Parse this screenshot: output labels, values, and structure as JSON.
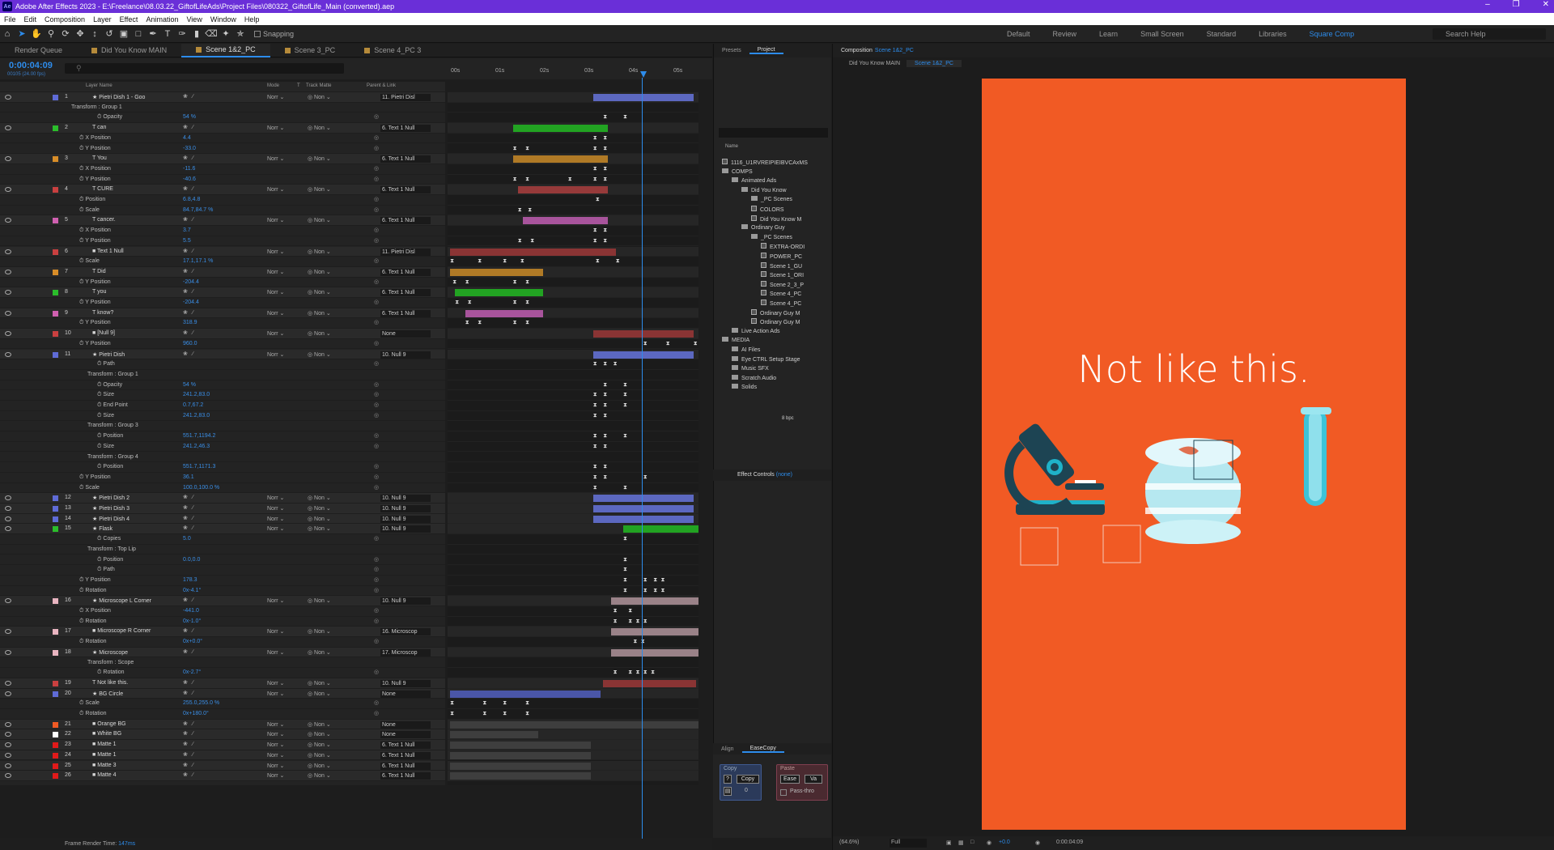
{
  "app": {
    "title": "Adobe After Effects 2023 - E:\\Freelance\\08.03.22_GiftofLifeAds\\Project Files\\080322_GiftofLife_Main (converted).aep",
    "logo": "Ae"
  },
  "menu": [
    "File",
    "Edit",
    "Composition",
    "Layer",
    "Effect",
    "Animation",
    "View",
    "Window",
    "Help"
  ],
  "toolbar": {
    "snapping_label": "Snapping",
    "workspaces": [
      "Default",
      "Review",
      "Learn",
      "Small Screen",
      "Standard",
      "Libraries",
      "Square Comp"
    ],
    "active_workspace": "Square Comp",
    "search_help": "Search Help"
  },
  "timeline": {
    "tabs": [
      "Render Queue",
      "Did You Know MAIN",
      "Scene 1&2_PC",
      "Scene 3_PC",
      "Scene 4_PC 3"
    ],
    "active_tab": "Scene 1&2_PC",
    "timecode": "0:00:04:09",
    "fps": "00105 (24.00 fps)",
    "ruler": [
      "00s",
      "01s",
      "02s",
      "03s",
      "04s",
      "05s"
    ],
    "columns": {
      "layer_name": "Layer Name",
      "mode": "Mode",
      "t": "T",
      "track_matte": "Track Matte",
      "parent": "Parent & Link"
    },
    "render_time_label": "Frame Render Time:",
    "render_time_value": "147ms"
  },
  "rows": [
    {
      "t": "L",
      "num": "1",
      "name": "Pietri Dish 1 - Goo",
      "label": "#5f6bd6",
      "type": "star",
      "parent": "11. Pietri Disl",
      "bar": [
        58,
        98
      ],
      "barc": "#5c68c0"
    },
    {
      "t": "G",
      "name": "Transform : Group 1",
      "ind": 88
    },
    {
      "t": "P",
      "name": "Opacity",
      "ind": 120,
      "val": "54 %",
      "kf": [
        62,
        70
      ]
    },
    {
      "t": "L",
      "num": "2",
      "name": "can",
      "label": "#2bbd2b",
      "type": "T",
      "parent": "6. Text 1 Null",
      "bar": [
        26,
        64
      ],
      "barc": "#22a322"
    },
    {
      "t": "P",
      "name": "X Position",
      "ind": 98,
      "val": "4.4",
      "kf": [
        58,
        62
      ]
    },
    {
      "t": "P",
      "name": "Y Position",
      "ind": 98,
      "val": "-33.0",
      "kf": [
        26,
        31,
        58,
        62
      ]
    },
    {
      "t": "L",
      "num": "3",
      "name": "You",
      "label": "#d88d28",
      "type": "T",
      "parent": "6. Text 1 Null",
      "bar": [
        26,
        64
      ],
      "barc": "#b07a26"
    },
    {
      "t": "P",
      "name": "X Position",
      "ind": 98,
      "val": "-11.6",
      "kf": [
        58,
        62
      ]
    },
    {
      "t": "P",
      "name": "Y Position",
      "ind": 98,
      "val": "-40.6",
      "kf": [
        26,
        31,
        48,
        58,
        62
      ]
    },
    {
      "t": "L",
      "num": "4",
      "name": "CURE",
      "label": "#c94040",
      "type": "T",
      "parent": "6. Text 1 Null",
      "bar": [
        28,
        64
      ],
      "barc": "#963a3a"
    },
    {
      "t": "P",
      "name": "Position",
      "ind": 98,
      "val": "6.8,4.8",
      "kf": [
        59
      ]
    },
    {
      "t": "P",
      "name": "Scale",
      "ind": 98,
      "val": "84.7,84.7 %",
      "kf": [
        28,
        32
      ]
    },
    {
      "t": "L",
      "num": "5",
      "name": "cancer.",
      "label": "#d060b0",
      "type": "T",
      "parent": "6. Text 1 Null",
      "bar": [
        30,
        64
      ],
      "barc": "#a8549c"
    },
    {
      "t": "P",
      "name": "X Position",
      "ind": 98,
      "val": "3.7",
      "kf": [
        58,
        62
      ]
    },
    {
      "t": "P",
      "name": "Y Position",
      "ind": 98,
      "val": "5.5",
      "kf": [
        28,
        33,
        58,
        62
      ]
    },
    {
      "t": "L",
      "num": "6",
      "name": "Text 1 Null",
      "label": "#c94040",
      "type": "n",
      "parent": "11. Pietri Disl",
      "bar": [
        1,
        67
      ],
      "barc": "#8a3434"
    },
    {
      "t": "P",
      "name": "Scale",
      "ind": 98,
      "val": "17.1,17.1 %",
      "kf": [
        1,
        12,
        22,
        29,
        59,
        67
      ]
    },
    {
      "t": "L",
      "num": "7",
      "name": "Did",
      "label": "#d88d28",
      "type": "T",
      "parent": "6. Text 1 Null",
      "bar": [
        1,
        38
      ],
      "barc": "#b07a26"
    },
    {
      "t": "P",
      "name": "Y Position",
      "ind": 98,
      "val": "-204.4",
      "kf": [
        2,
        7,
        26,
        31
      ]
    },
    {
      "t": "L",
      "num": "8",
      "name": "you",
      "label": "#2bbd2b",
      "type": "T",
      "parent": "6. Text 1 Null",
      "bar": [
        3,
        38
      ],
      "barc": "#22a322"
    },
    {
      "t": "P",
      "name": "Y Position",
      "ind": 98,
      "val": "-204.4",
      "kf": [
        3,
        8,
        26,
        31
      ]
    },
    {
      "t": "L",
      "num": "9",
      "name": "know?",
      "label": "#d060b0",
      "type": "T",
      "parent": "6. Text 1 Null",
      "bar": [
        7,
        38
      ],
      "barc": "#a8549c"
    },
    {
      "t": "P",
      "name": "Y Position",
      "ind": 98,
      "val": "318.9",
      "kf": [
        7,
        12,
        26,
        31
      ]
    },
    {
      "t": "L",
      "num": "10",
      "name": "[Null 9]",
      "label": "#c94040",
      "type": "n",
      "parent": "None",
      "bar": [
        58,
        98
      ],
      "barc": "#8a3434"
    },
    {
      "t": "P",
      "name": "Y Position",
      "ind": 98,
      "val": "960.0",
      "kf": [
        78,
        87,
        98
      ]
    },
    {
      "t": "L",
      "num": "11",
      "name": "Pietri Dish",
      "label": "#5f6bd6",
      "type": "star",
      "parent": "10. Null 9",
      "bar": [
        58,
        98
      ],
      "barc": "#5c68c0"
    },
    {
      "t": "P",
      "name": "Path",
      "ind": 120,
      "val": "",
      "kf": [
        58,
        62,
        66
      ]
    },
    {
      "t": "G",
      "name": "Transform : Group 1",
      "ind": 108
    },
    {
      "t": "P",
      "name": "Opacity",
      "ind": 120,
      "val": "54 %",
      "kf": [
        62,
        70
      ]
    },
    {
      "t": "P",
      "name": "Size",
      "ind": 120,
      "val": "241.2,83.0",
      "kf": [
        58,
        62,
        70
      ]
    },
    {
      "t": "P",
      "name": "End Point",
      "ind": 120,
      "val": "0.7,67.2",
      "kf": [
        58,
        62,
        70
      ]
    },
    {
      "t": "P",
      "name": "Size",
      "ind": 120,
      "val": "241.2,83.0",
      "kf": [
        58,
        62
      ]
    },
    {
      "t": "G",
      "name": "Transform : Group 3",
      "ind": 108
    },
    {
      "t": "P",
      "name": "Position",
      "ind": 120,
      "val": "551.7,1194.2",
      "kf": [
        58,
        62,
        70
      ]
    },
    {
      "t": "P",
      "name": "Size",
      "ind": 120,
      "val": "241.2,46.3",
      "kf": [
        58,
        62
      ]
    },
    {
      "t": "G",
      "name": "Transform : Group 4",
      "ind": 108
    },
    {
      "t": "P",
      "name": "Position",
      "ind": 120,
      "val": "551.7,1171.3",
      "kf": [
        58,
        62
      ]
    },
    {
      "t": "P",
      "name": "Y Position",
      "ind": 98,
      "val": "36.1",
      "kf": [
        58,
        62,
        78
      ]
    },
    {
      "t": "P",
      "name": "Scale",
      "ind": 98,
      "val": "100.0,100.0 %",
      "kf": [
        58,
        70
      ]
    },
    {
      "t": "L",
      "num": "12",
      "name": "Pietri Dish 2",
      "label": "#5f6bd6",
      "type": "star",
      "parent": "10. Null 9",
      "bar": [
        58,
        98
      ],
      "barc": "#5c68c0"
    },
    {
      "t": "L",
      "num": "13",
      "name": "Pietri Dish 3",
      "label": "#5f6bd6",
      "type": "star",
      "parent": "10. Null 9",
      "bar": [
        58,
        98
      ],
      "barc": "#5c68c0"
    },
    {
      "t": "L",
      "num": "14",
      "name": "Pietri Dish 4",
      "label": "#5f6bd6",
      "type": "star",
      "parent": "10. Null 9",
      "bar": [
        58,
        98
      ],
      "barc": "#5c68c0"
    },
    {
      "t": "L",
      "num": "15",
      "name": "Flask",
      "label": "#2bbd2b",
      "type": "star",
      "parent": "10. Null 9",
      "bar": [
        70,
        100
      ],
      "barc": "#22a322"
    },
    {
      "t": "P",
      "name": "Copies",
      "ind": 120,
      "val": "5.0",
      "kf": [
        70
      ]
    },
    {
      "t": "G",
      "name": "Transform : Top Lip",
      "ind": 108
    },
    {
      "t": "P",
      "name": "Position",
      "ind": 120,
      "val": "0.0,0.0",
      "kf": [
        70
      ]
    },
    {
      "t": "P",
      "name": "Path",
      "ind": 120,
      "val": "",
      "kf": [
        70
      ]
    },
    {
      "t": "P",
      "name": "Y Position",
      "ind": 98,
      "val": "178.3",
      "kf": [
        70,
        78,
        82,
        85
      ]
    },
    {
      "t": "P",
      "name": "Rotation",
      "ind": 98,
      "val": "0x-4.1°",
      "kf": [
        70,
        78,
        82,
        85
      ]
    },
    {
      "t": "L",
      "num": "16",
      "name": "Microscope L Corner",
      "label": "#e8b4c0",
      "type": "star",
      "parent": "10. Null 9",
      "bar": [
        65,
        100
      ],
      "barc": "#9a8288"
    },
    {
      "t": "P",
      "name": "X Position",
      "ind": 98,
      "val": "-441.0",
      "kf": [
        66,
        72
      ]
    },
    {
      "t": "P",
      "name": "Rotation",
      "ind": 98,
      "val": "0x-1.0°",
      "kf": [
        66,
        72,
        75,
        78
      ]
    },
    {
      "t": "L",
      "num": "17",
      "name": "Microscope R Corner",
      "label": "#e8b4c0",
      "type": "n",
      "parent": "16. Microscop",
      "bar": [
        65,
        100
      ],
      "barc": "#9a8288"
    },
    {
      "t": "P",
      "name": "Rotation",
      "ind": 98,
      "val": "0x+0.0°",
      "kf": [
        74,
        77
      ]
    },
    {
      "t": "L",
      "num": "18",
      "name": "Microscope",
      "label": "#e8b4c0",
      "type": "star",
      "parent": "17. Microscop",
      "bar": [
        65,
        100
      ],
      "barc": "#9a8288"
    },
    {
      "t": "G",
      "name": "Transform : Scope",
      "ind": 108
    },
    {
      "t": "P",
      "name": "Rotation",
      "ind": 120,
      "val": "0x-2.7°",
      "kf": [
        66,
        72,
        75,
        78,
        81
      ]
    },
    {
      "t": "L",
      "num": "19",
      "name": "Not like this.",
      "label": "#c94040",
      "type": "T",
      "parent": "10. Null 9",
      "bar": [
        62,
        99
      ],
      "barc": "#8a3434"
    },
    {
      "t": "L",
      "num": "20",
      "name": "BG Circle",
      "label": "#5f6bd6",
      "type": "star",
      "parent": "None",
      "bar": [
        1,
        61
      ],
      "barc": "#4a56a8"
    },
    {
      "t": "P",
      "name": "Scale",
      "ind": 98,
      "val": "255.0,255.0 %",
      "kf": [
        1,
        14,
        22,
        31
      ]
    },
    {
      "t": "P",
      "name": "Rotation",
      "ind": 98,
      "val": "0x+180.0°",
      "kf": [
        1,
        14,
        22,
        31
      ]
    },
    {
      "t": "L",
      "num": "21",
      "name": "Orange BG",
      "label": "#f15a24",
      "type": "n",
      "parent": "None",
      "bar": [
        1,
        100
      ],
      "barc": "#3e3e3e"
    },
    {
      "t": "L",
      "num": "22",
      "name": "White BG",
      "label": "#ffffff",
      "type": "n",
      "parent": "None",
      "bar": [
        1,
        36
      ],
      "barc": "#3e3e3e"
    },
    {
      "t": "L",
      "num": "23",
      "name": "Matte 1",
      "label": "#e01a1a",
      "type": "n",
      "parent": "6. Text 1 Null",
      "bar": [
        1,
        57
      ],
      "barc": "#3e3e3e"
    },
    {
      "t": "L",
      "num": "24",
      "name": "Matte 1",
      "label": "#e01a1a",
      "type": "n",
      "parent": "6. Text 1 Null",
      "bar": [
        1,
        57
      ],
      "barc": "#3e3e3e"
    },
    {
      "t": "L",
      "num": "25",
      "name": "Matte 3",
      "label": "#e01a1a",
      "type": "n",
      "parent": "6. Text 1 Null",
      "bar": [
        1,
        57
      ],
      "barc": "#3e3e3e"
    },
    {
      "t": "L",
      "num": "26",
      "name": "Matte 4",
      "label": "#e01a1a",
      "type": "n",
      "parent": "6. Text 1 Null",
      "bar": [
        1,
        57
      ],
      "barc": "#3e3e3e"
    }
  ],
  "project": {
    "tabs": [
      "Presets",
      "Project"
    ],
    "active_tab": "Project",
    "name_header": "Name",
    "items": [
      {
        "label": "1116_U1RVREIPIEIBVCAxMS",
        "kind": "file",
        "lvl": 0
      },
      {
        "label": "COMPS",
        "kind": "folder",
        "lvl": 0
      },
      {
        "label": "Animated Ads",
        "kind": "folder",
        "lvl": 1
      },
      {
        "label": "Did You Know",
        "kind": "folder",
        "lvl": 2
      },
      {
        "label": "_PC Scenes",
        "kind": "folder",
        "lvl": 3
      },
      {
        "label": "COLORS",
        "kind": "comp",
        "lvl": 3
      },
      {
        "label": "Did You Know M",
        "kind": "comp",
        "lvl": 3
      },
      {
        "label": "Ordinary Guy",
        "kind": "folder",
        "lvl": 2
      },
      {
        "label": "_PC Scenes",
        "kind": "folder",
        "lvl": 3
      },
      {
        "label": "EXTRA-ORDI",
        "kind": "comp",
        "lvl": 4
      },
      {
        "label": "POWER_PC",
        "kind": "comp",
        "lvl": 4
      },
      {
        "label": "Scene 1_GU",
        "kind": "comp",
        "lvl": 4
      },
      {
        "label": "Scene 1_ORI",
        "kind": "comp",
        "lvl": 4
      },
      {
        "label": "Scene 2_3_P",
        "kind": "comp",
        "lvl": 4
      },
      {
        "label": "Scene 4_PC",
        "kind": "comp",
        "lvl": 4
      },
      {
        "label": "Scene 4_PC",
        "kind": "comp",
        "lvl": 4
      },
      {
        "label": "Ordinary Guy M",
        "kind": "comp",
        "lvl": 3
      },
      {
        "label": "Ordinary Guy M",
        "kind": "comp",
        "lvl": 3
      },
      {
        "label": "Live Action Ads",
        "kind": "folder",
        "lvl": 1
      },
      {
        "label": "MEDIA",
        "kind": "folder",
        "lvl": 0
      },
      {
        "label": "AI Files",
        "kind": "folder",
        "lvl": 1
      },
      {
        "label": "Eye CTRL Setup Stage",
        "kind": "folder",
        "lvl": 1
      },
      {
        "label": "Music SFX",
        "kind": "folder",
        "lvl": 1
      },
      {
        "label": "Scratch Audio",
        "kind": "folder",
        "lvl": 1
      },
      {
        "label": "Solids",
        "kind": "folder",
        "lvl": 1
      }
    ],
    "bpc": "8 bpc"
  },
  "effect_controls": {
    "label": "Effect Controls",
    "value": "(none)"
  },
  "easecopy": {
    "tabs": [
      "Align",
      "EaseCopy"
    ],
    "active_tab": "EaseCopy",
    "copy_title": "Copy",
    "copy_button": "Copy",
    "copy_count": "0",
    "paste_title": "Paste",
    "ease_button": "Ease",
    "val_button": "Va",
    "passthrough": "Pass-thro"
  },
  "composition": {
    "tab_label": "Composition",
    "comp_name": "Scene 1&2_PC",
    "breadcrumbs": [
      "Did You Know MAIN",
      "Scene 1&2_PC"
    ],
    "canvas_text": "Not like this.",
    "bg_color": "#f15a24",
    "zoom": "(64.6%)",
    "resolution": "Full",
    "exposure": "+0.0",
    "timecode": "0:00:04:09"
  }
}
